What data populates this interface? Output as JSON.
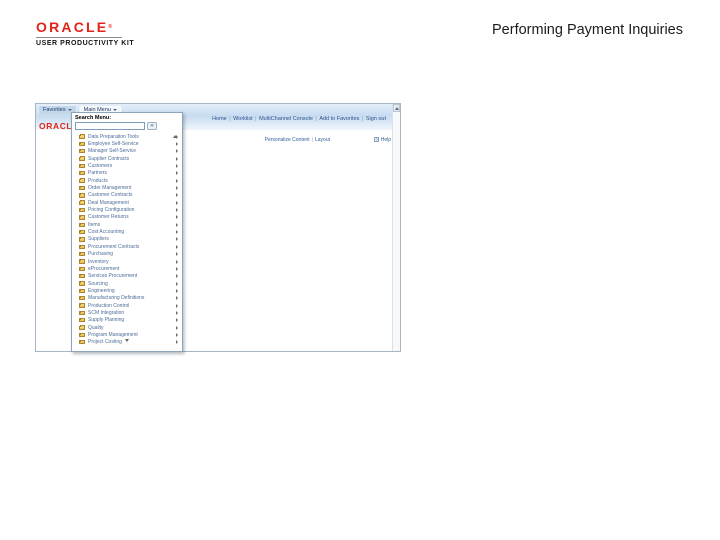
{
  "slide": {
    "title": "Performing Payment Inquiries",
    "logo": {
      "brand": "ORACLE",
      "mark": "®",
      "subtitle": "USER PRODUCTIVITY KIT"
    }
  },
  "app": {
    "brand": "ORACLE",
    "tabs": [
      {
        "id": "favorites",
        "label": "Favorites",
        "active": false
      },
      {
        "id": "main-menu",
        "label": "Main Menu",
        "active": true
      }
    ],
    "header_links": [
      "Home",
      "Worklist",
      "MultiChannel Console",
      "Add to Favorites",
      "Sign out"
    ],
    "personalize_links": [
      "Personalize Content",
      "Layout"
    ],
    "help_label": "Help",
    "menu": {
      "search_label": "Search Menu:",
      "search_value": "",
      "items": [
        "Data Preparation Tools",
        "Employee Self-Service",
        "Manager Self-Service",
        "Supplier Contracts",
        "Customers",
        "Partners",
        "Products",
        "Order Management",
        "Customer Contracts",
        "Deal Management",
        "Pricing Configuration",
        "Customer Returns",
        "Items",
        "Cost Accounting",
        "Suppliers",
        "Procurement Contracts",
        "Purchasing",
        "Inventory",
        "eProcurement",
        "Services Procurement",
        "Sourcing",
        "Engineering",
        "Manufacturing Definitions",
        "Production Control",
        "SCM Integration",
        "Supply Planning",
        "Quality",
        "Program Management",
        "Project Costing"
      ]
    },
    "colors": {
      "accent_red": "#e2231a",
      "banner_blue": "#c7dbf0",
      "link_blue": "#27518b",
      "menu_text": "#4d6d99",
      "folder_yellow": "#e6b94b"
    }
  }
}
